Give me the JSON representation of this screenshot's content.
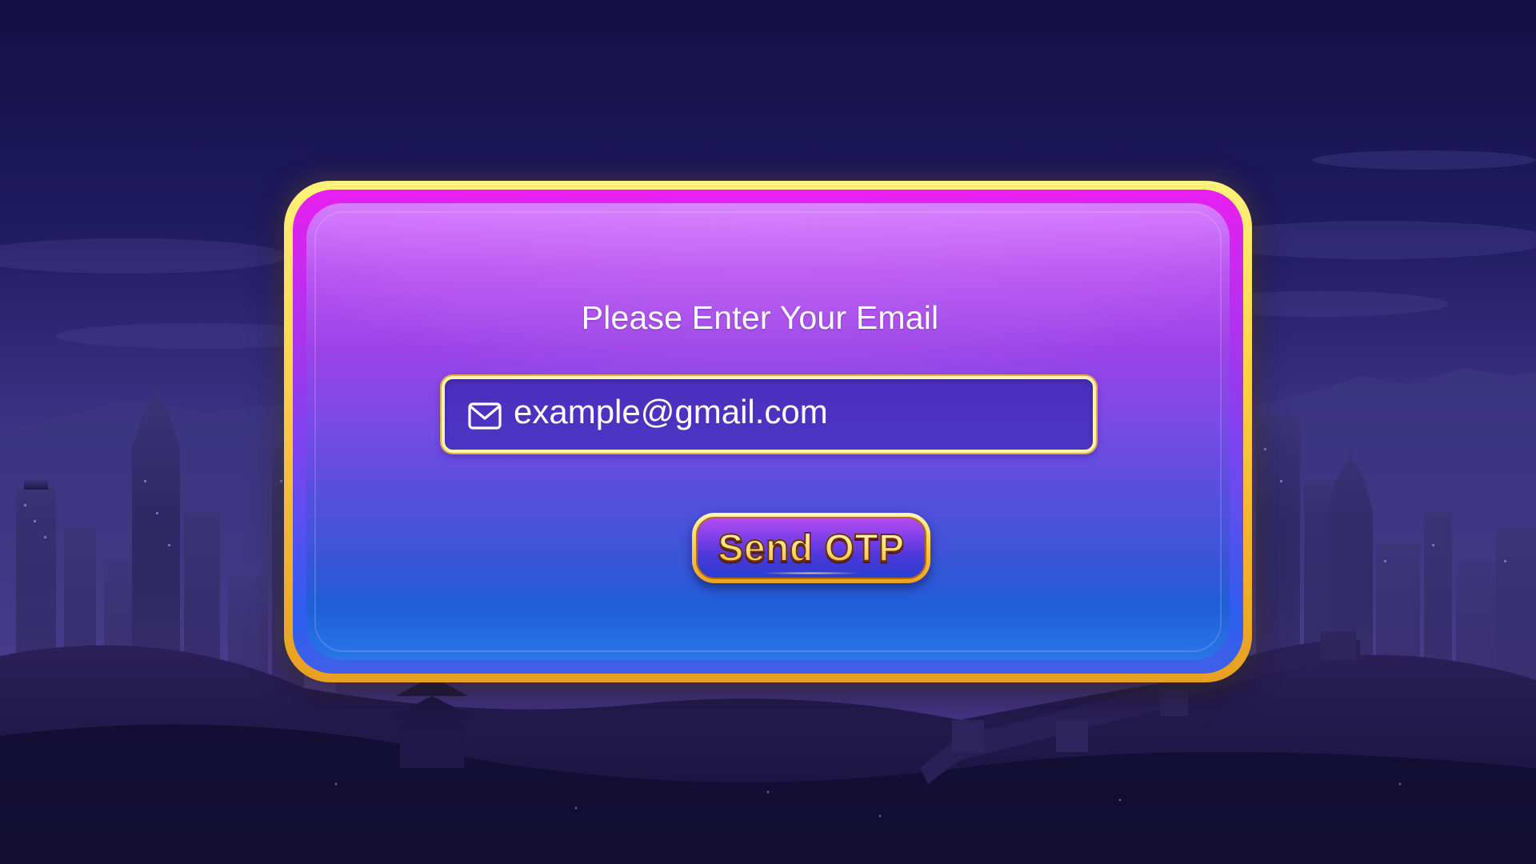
{
  "dialog": {
    "title": "Please Enter Your Email"
  },
  "email_field": {
    "placeholder": "example@gmail.com",
    "icon": "mail-icon"
  },
  "send_otp_button": {
    "label": "Send OTP"
  },
  "colors": {
    "frame_gold": "#ffd54a",
    "panel_top": "#d578ff",
    "panel_bottom": "#2a75e8",
    "field_bg": "#4a2fbd",
    "button_text": "#ffe27a"
  }
}
